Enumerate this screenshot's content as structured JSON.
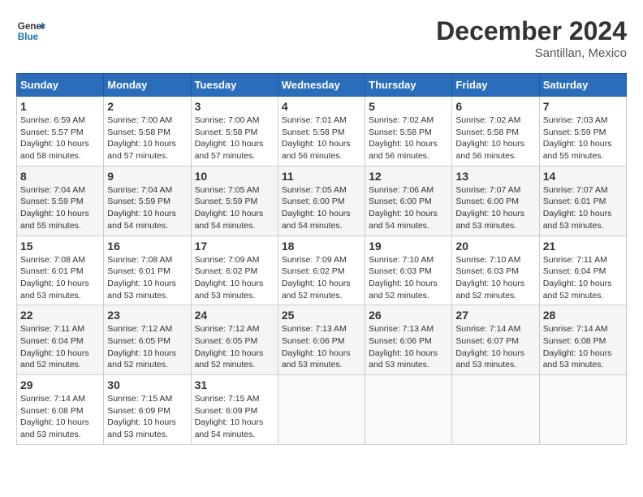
{
  "header": {
    "logo_general": "General",
    "logo_blue": "Blue",
    "month_title": "December 2024",
    "location": "Santillan, Mexico"
  },
  "weekdays": [
    "Sunday",
    "Monday",
    "Tuesday",
    "Wednesday",
    "Thursday",
    "Friday",
    "Saturday"
  ],
  "weeks": [
    [
      {
        "day": "1",
        "sunrise": "Sunrise: 6:59 AM",
        "sunset": "Sunset: 5:57 PM",
        "daylight": "Daylight: 10 hours and 58 minutes."
      },
      {
        "day": "2",
        "sunrise": "Sunrise: 7:00 AM",
        "sunset": "Sunset: 5:58 PM",
        "daylight": "Daylight: 10 hours and 57 minutes."
      },
      {
        "day": "3",
        "sunrise": "Sunrise: 7:00 AM",
        "sunset": "Sunset: 5:58 PM",
        "daylight": "Daylight: 10 hours and 57 minutes."
      },
      {
        "day": "4",
        "sunrise": "Sunrise: 7:01 AM",
        "sunset": "Sunset: 5:58 PM",
        "daylight": "Daylight: 10 hours and 56 minutes."
      },
      {
        "day": "5",
        "sunrise": "Sunrise: 7:02 AM",
        "sunset": "Sunset: 5:58 PM",
        "daylight": "Daylight: 10 hours and 56 minutes."
      },
      {
        "day": "6",
        "sunrise": "Sunrise: 7:02 AM",
        "sunset": "Sunset: 5:58 PM",
        "daylight": "Daylight: 10 hours and 56 minutes."
      },
      {
        "day": "7",
        "sunrise": "Sunrise: 7:03 AM",
        "sunset": "Sunset: 5:59 PM",
        "daylight": "Daylight: 10 hours and 55 minutes."
      }
    ],
    [
      {
        "day": "8",
        "sunrise": "Sunrise: 7:04 AM",
        "sunset": "Sunset: 5:59 PM",
        "daylight": "Daylight: 10 hours and 55 minutes."
      },
      {
        "day": "9",
        "sunrise": "Sunrise: 7:04 AM",
        "sunset": "Sunset: 5:59 PM",
        "daylight": "Daylight: 10 hours and 54 minutes."
      },
      {
        "day": "10",
        "sunrise": "Sunrise: 7:05 AM",
        "sunset": "Sunset: 5:59 PM",
        "daylight": "Daylight: 10 hours and 54 minutes."
      },
      {
        "day": "11",
        "sunrise": "Sunrise: 7:05 AM",
        "sunset": "Sunset: 6:00 PM",
        "daylight": "Daylight: 10 hours and 54 minutes."
      },
      {
        "day": "12",
        "sunrise": "Sunrise: 7:06 AM",
        "sunset": "Sunset: 6:00 PM",
        "daylight": "Daylight: 10 hours and 54 minutes."
      },
      {
        "day": "13",
        "sunrise": "Sunrise: 7:07 AM",
        "sunset": "Sunset: 6:00 PM",
        "daylight": "Daylight: 10 hours and 53 minutes."
      },
      {
        "day": "14",
        "sunrise": "Sunrise: 7:07 AM",
        "sunset": "Sunset: 6:01 PM",
        "daylight": "Daylight: 10 hours and 53 minutes."
      }
    ],
    [
      {
        "day": "15",
        "sunrise": "Sunrise: 7:08 AM",
        "sunset": "Sunset: 6:01 PM",
        "daylight": "Daylight: 10 hours and 53 minutes."
      },
      {
        "day": "16",
        "sunrise": "Sunrise: 7:08 AM",
        "sunset": "Sunset: 6:01 PM",
        "daylight": "Daylight: 10 hours and 53 minutes."
      },
      {
        "day": "17",
        "sunrise": "Sunrise: 7:09 AM",
        "sunset": "Sunset: 6:02 PM",
        "daylight": "Daylight: 10 hours and 53 minutes."
      },
      {
        "day": "18",
        "sunrise": "Sunrise: 7:09 AM",
        "sunset": "Sunset: 6:02 PM",
        "daylight": "Daylight: 10 hours and 52 minutes."
      },
      {
        "day": "19",
        "sunrise": "Sunrise: 7:10 AM",
        "sunset": "Sunset: 6:03 PM",
        "daylight": "Daylight: 10 hours and 52 minutes."
      },
      {
        "day": "20",
        "sunrise": "Sunrise: 7:10 AM",
        "sunset": "Sunset: 6:03 PM",
        "daylight": "Daylight: 10 hours and 52 minutes."
      },
      {
        "day": "21",
        "sunrise": "Sunrise: 7:11 AM",
        "sunset": "Sunset: 6:04 PM",
        "daylight": "Daylight: 10 hours and 52 minutes."
      }
    ],
    [
      {
        "day": "22",
        "sunrise": "Sunrise: 7:11 AM",
        "sunset": "Sunset: 6:04 PM",
        "daylight": "Daylight: 10 hours and 52 minutes."
      },
      {
        "day": "23",
        "sunrise": "Sunrise: 7:12 AM",
        "sunset": "Sunset: 6:05 PM",
        "daylight": "Daylight: 10 hours and 52 minutes."
      },
      {
        "day": "24",
        "sunrise": "Sunrise: 7:12 AM",
        "sunset": "Sunset: 6:05 PM",
        "daylight": "Daylight: 10 hours and 52 minutes."
      },
      {
        "day": "25",
        "sunrise": "Sunrise: 7:13 AM",
        "sunset": "Sunset: 6:06 PM",
        "daylight": "Daylight: 10 hours and 53 minutes."
      },
      {
        "day": "26",
        "sunrise": "Sunrise: 7:13 AM",
        "sunset": "Sunset: 6:06 PM",
        "daylight": "Daylight: 10 hours and 53 minutes."
      },
      {
        "day": "27",
        "sunrise": "Sunrise: 7:14 AM",
        "sunset": "Sunset: 6:07 PM",
        "daylight": "Daylight: 10 hours and 53 minutes."
      },
      {
        "day": "28",
        "sunrise": "Sunrise: 7:14 AM",
        "sunset": "Sunset: 6:08 PM",
        "daylight": "Daylight: 10 hours and 53 minutes."
      }
    ],
    [
      {
        "day": "29",
        "sunrise": "Sunrise: 7:14 AM",
        "sunset": "Sunset: 6:08 PM",
        "daylight": "Daylight: 10 hours and 53 minutes."
      },
      {
        "day": "30",
        "sunrise": "Sunrise: 7:15 AM",
        "sunset": "Sunset: 6:09 PM",
        "daylight": "Daylight: 10 hours and 53 minutes."
      },
      {
        "day": "31",
        "sunrise": "Sunrise: 7:15 AM",
        "sunset": "Sunset: 6:09 PM",
        "daylight": "Daylight: 10 hours and 54 minutes."
      },
      null,
      null,
      null,
      null
    ]
  ]
}
